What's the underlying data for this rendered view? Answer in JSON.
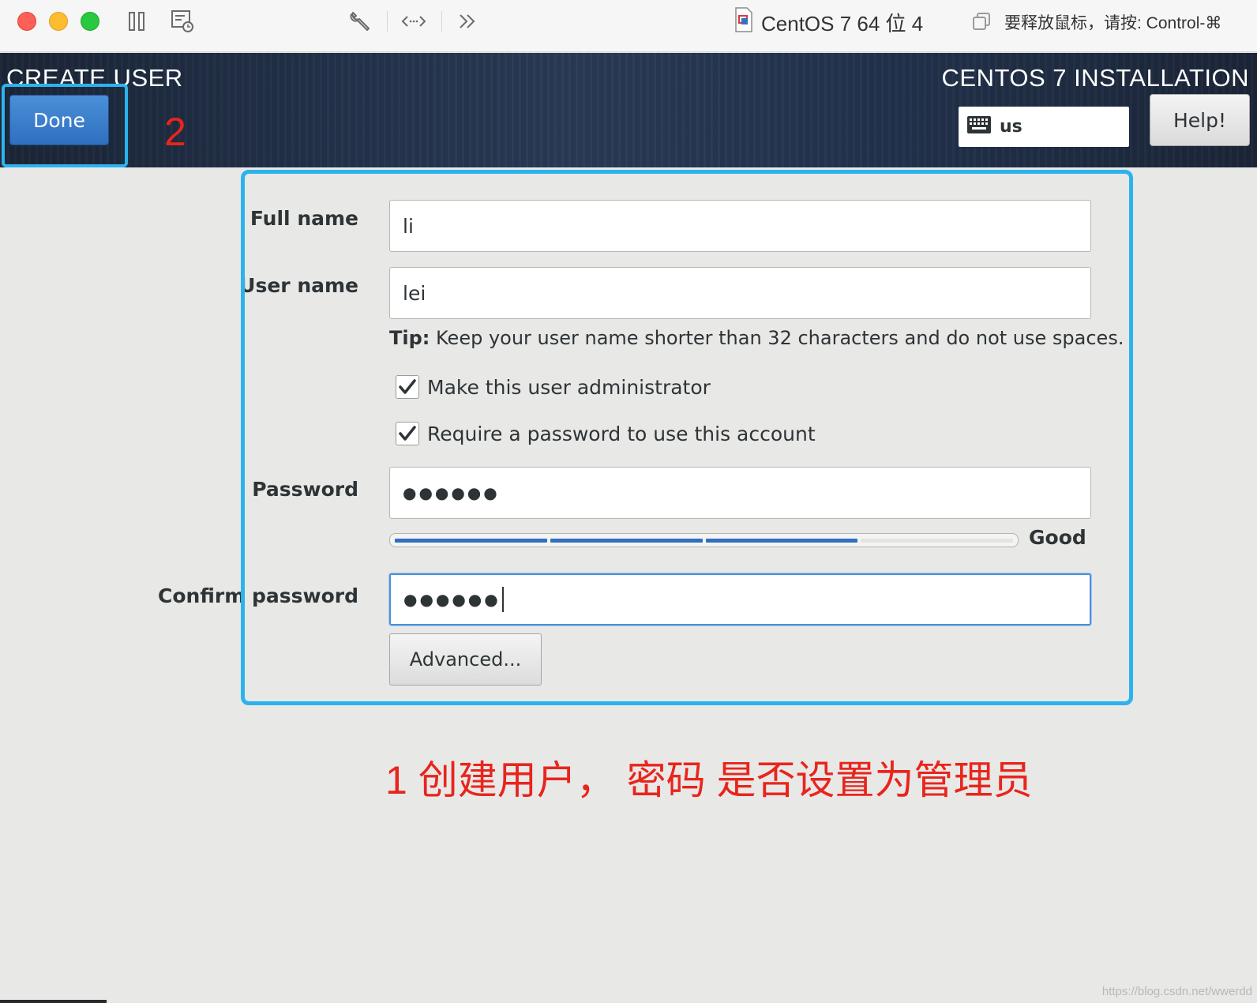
{
  "host": {
    "vm_title": "CentOS 7 64 位 4",
    "release_hint": "要释放鼠标，请按: Control-⌘"
  },
  "header": {
    "spoke_title": "CREATE USER",
    "product_title": "CENTOS 7 INSTALLATION",
    "done_label": "Done",
    "help_label": "Help!",
    "keyboard_layout": "us"
  },
  "form": {
    "full_name_label": "Full name",
    "full_name_value": "li",
    "user_name_label": "User name",
    "user_name_value": "lei",
    "tip_prefix": "Tip:",
    "tip_text": " Keep your user name shorter than 32 characters and do not use spaces.",
    "admin_checkbox_label": "Make this user administrator",
    "admin_checked": true,
    "require_pw_label": "Require a password to use this account",
    "require_pw_checked": true,
    "password_label": "Password",
    "password_masked": "●●●●●●",
    "strength_segments_filled": 3,
    "strength_segments_total": 4,
    "strength_label": "Good",
    "confirm_label": "Confirm password",
    "confirm_masked": "●●●●●●",
    "advanced_label": "Advanced..."
  },
  "annotations": {
    "step_1": "1 创建用户，  密码  是否设置为管理员",
    "step_2": "2",
    "highlight_color": "#2cb3ee",
    "annotation_color": "#e8251c"
  },
  "watermark": "https://blog.csdn.net/wwerdd"
}
